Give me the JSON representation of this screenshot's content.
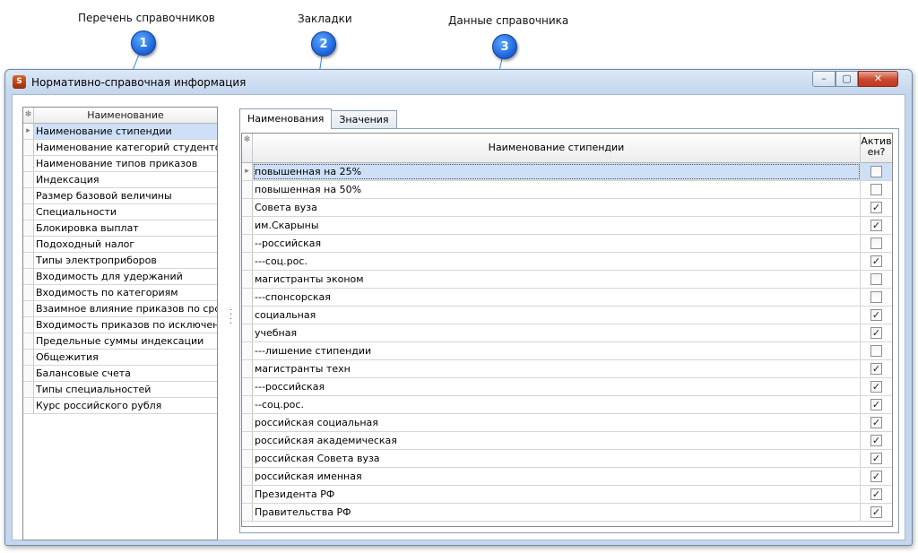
{
  "callouts": [
    {
      "label": "Перечень справочников",
      "number": "1"
    },
    {
      "label": "Закладки",
      "number": "2"
    },
    {
      "label": "Данные справочника",
      "number": "3"
    }
  ],
  "window": {
    "title": "Нормативно-справочная информация",
    "app_icon_text": "S",
    "controls": {
      "minimize": "–",
      "maximize": "▢",
      "close": "✕"
    }
  },
  "left_grid": {
    "indicator_header": "✻",
    "header": "Наименование",
    "items": [
      "Наименование стипендии",
      "Наименование категорий студентов",
      "Наименование типов приказов",
      "Индексация",
      "Размер базовой величины",
      "Специальности",
      "Блокировка выплат",
      "Подоходный налог",
      "Типы электроприборов",
      "Входимость для удержаний",
      "Входимость по категориям",
      "Взаимное влияние приказов по срокам",
      "Входимость приказов по исключению",
      "Предельные суммы индексации",
      "Общежития",
      "Балансовые счета",
      "Типы специальностей",
      "Курс российского рубля"
    ],
    "selected_index": 0
  },
  "tabs": [
    {
      "label": "Наименования",
      "active": true
    },
    {
      "label": "Значения",
      "active": false
    }
  ],
  "right_grid": {
    "indicator_header": "✻",
    "header_name": "Наименование стипендии",
    "header_active": "Актив ен?",
    "rows": [
      {
        "name": "повышенная на 25%",
        "active": false
      },
      {
        "name": "повышенная на 50%",
        "active": false
      },
      {
        "name": "Совета вуза",
        "active": true
      },
      {
        "name": "им.Скарыны",
        "active": true
      },
      {
        "name": "--российская",
        "active": false
      },
      {
        "name": "---соц.рос.",
        "active": true
      },
      {
        "name": "магистранты эконом",
        "active": false
      },
      {
        "name": "---спонсорская",
        "active": false
      },
      {
        "name": "социальная",
        "active": true
      },
      {
        "name": "учебная",
        "active": true
      },
      {
        "name": "---лишение стипендии",
        "active": false
      },
      {
        "name": "магистранты техн",
        "active": true
      },
      {
        "name": "---российская",
        "active": true
      },
      {
        "name": "--соц.рос.",
        "active": true
      },
      {
        "name": "российская социальная",
        "active": true
      },
      {
        "name": "российская академическая",
        "active": true
      },
      {
        "name": "российская Совета вуза",
        "active": true
      },
      {
        "name": "российская именная",
        "active": true
      },
      {
        "name": "Президента РФ",
        "active": true
      },
      {
        "name": "Правительства РФ",
        "active": true
      }
    ],
    "selected_index": 0
  },
  "colors": {
    "selection": "#cde0f7",
    "badge": "#1a5fd6",
    "close_button": "#c9462c"
  }
}
